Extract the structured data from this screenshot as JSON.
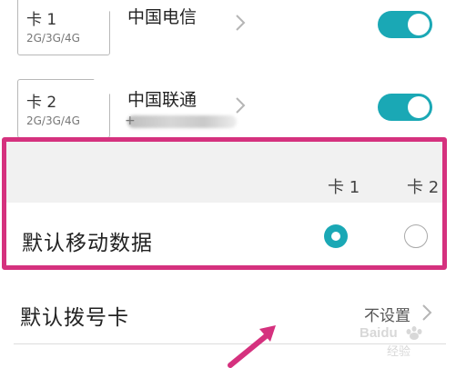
{
  "sims": [
    {
      "slot_label": "卡 1",
      "network": "2G/3G/4G",
      "carrier": "中国电信",
      "enabled": true
    },
    {
      "slot_label": "卡 2",
      "network": "2G/3G/4G",
      "carrier": "中国联通",
      "phone_prefix": "+",
      "enabled": true
    }
  ],
  "default_data": {
    "columns": [
      "卡 1",
      "卡 2"
    ],
    "label": "默认移动数据",
    "selected": "卡 1"
  },
  "default_dial": {
    "label": "默认拨号卡",
    "value": "不设置"
  },
  "colors": {
    "accent": "#1aa8b5",
    "highlight_border": "#d5317e"
  },
  "watermark": "Baidu 经验",
  "icons": {
    "chevron": "chevron-right-icon",
    "arrow": "annotation-arrow-icon",
    "logo": "baidu-paw-logo"
  }
}
